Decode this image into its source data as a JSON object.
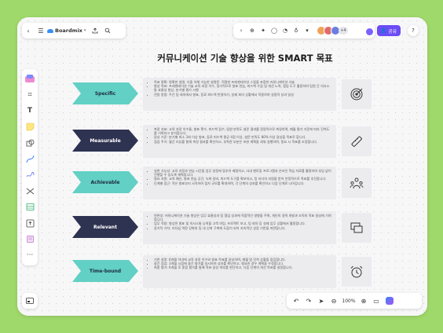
{
  "app": {
    "brand_name": "Boardmix",
    "share_label": "공유",
    "collaborator_count": "+4",
    "help_label": "?",
    "zoom_level": "100%"
  },
  "board": {
    "title": "커뮤니케이션 기술 향상을 위한 SMART 목표",
    "rows": [
      {
        "label": "Specific",
        "bg": "#62d0c4",
        "fg": "#1e2a44",
        "icon": "target-icon",
        "text": [
          "목표 명확: 명확한 설명, 다중 이해 가능한 설명문. 적절한 프레젠테이션 스킬을 포함한 커뮤니케이션 기술",
          "향상 목표: 프레젠테이션 기술 교육 과정 이수, 정기적으로 발표 연습, 피드백 수집 및 개선 노력, 협업 도구 활용하여 팀원 간 의사소통 효율성 향상, 분기별 평가 시행",
          "전달 방법: 주간 팀 회의에서 발표, 동료 피드백 반영하기, 실제 회의 상황에서 적용하여 실질적 성과 달성"
        ]
      },
      {
        "label": "Measurable",
        "bg": "#2f3352",
        "fg": "#ffffff",
        "icon": "ruler-icon",
        "text": [
          "측정 지표: 교육 과정 이수율, 발표 횟수, 피드백 점수, 팀원 만족도 설문 결과를 정량적으로 측정하며, 매월 평가 기준에 따라 진척도를 기록하고 분석합니다.",
          "달성 기준: 분기별 최소 3회 이상 발표, 동료 피드백 평균 4점 이상, 설문 만족도 80% 이상 달성을 목표로 합니다.",
          "점검 주기: 월간 리뷰를 통해 측정 결과를 확인하고, 부족한 부분은 보완 계획을 세워 실행하며, 필요 시 목표를 조정합니다."
        ]
      },
      {
        "label": "Achievable",
        "bg": "#62d0c4",
        "fg": "#1e2a44",
        "icon": "team-icon",
        "text": [
          "실현 가능성: 교육 과정과 연습 시간을 업무 일정에 맞추어 배정하고, 사내 멘토링 프로그램과 온라인 학습 자료를 활용하여 부담 없이 진행할 수 있도록 계획합니다.",
          "필요 자원: 교육 예산, 발표 연습 공간, 녹화 장비, 피드백 도구를 확보하고, 팀 리더의 지원을 받아 안정적으로 목표를 추진합니다.",
          "단계별 접근: 작은 발표부터 시작하여 점차 규모를 확대하며, 각 단계의 성과를 확인하고 다음 단계로 나아갑니다."
        ]
      },
      {
        "label": "Relevant",
        "bg": "#2f3352",
        "fg": "#ffffff",
        "icon": "presentation-icon",
        "text": [
          "연관성: 커뮤니케이션 기술 향상은 업무 효율성과 팀 협업 성과에 직접적인 영향을 주며, 개인의 경력 개발과 조직의 목표 달성에 기여합니다.",
          "업무 적용: 향상된 발표 및 의사소통 능력을 고객 미팅, 프로젝트 보고, 팀 회의 등 실제 업무 상황에서 활용합니다.",
          "장기적 가치: 리더십 역량 강화와 팀 내 신뢰 구축에 도움이 되어 지속적인 성장 기반을 마련합니다."
        ]
      },
      {
        "label": "Time-bound",
        "bg": "#62d0c4",
        "fg": "#1e2a44",
        "icon": "alarm-clock-icon",
        "text": [
          "기한 설정: 6개월 이내에 교육 과정 이수와 발표 목표를 달성하며, 매월 말 진척 상황을 점검합니다.",
          "중간 점검: 3개월 시점에 중간 평가를 실시하여 성과를 확인하고, 필요한 경우 계획을 수정합니다.",
          "최종 평가: 6개월 후 종합 평가를 통해 목표 달성 여부를 판단하고, 다음 단계의 개선 목표를 설정합니다."
        ]
      }
    ]
  }
}
